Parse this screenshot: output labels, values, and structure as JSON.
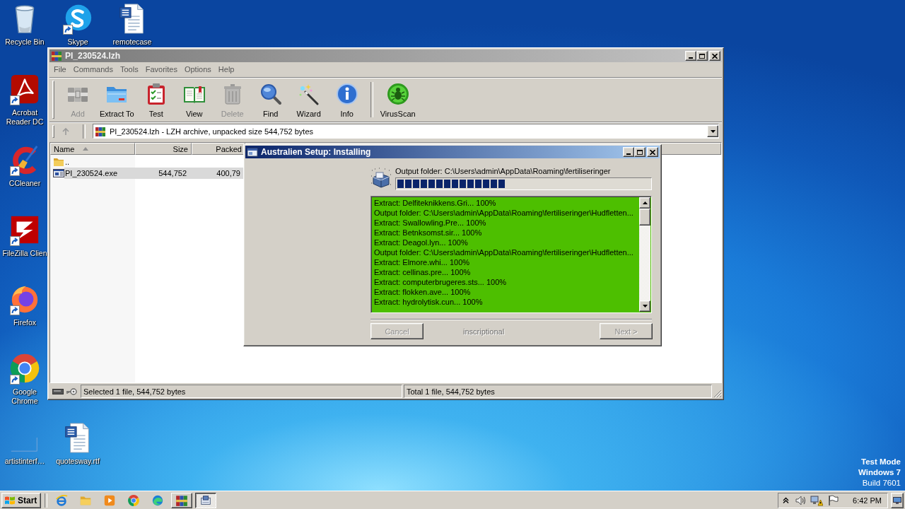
{
  "desktop": {
    "icons": [
      {
        "label": "Recycle Bin",
        "shortcut": false
      },
      {
        "label": "Skype",
        "shortcut": true
      },
      {
        "label": "remotecase",
        "shortcut": false
      },
      {
        "label": "Acrobat Reader DC",
        "shortcut": true
      },
      {
        "label": "CCleaner",
        "shortcut": true
      },
      {
        "label": "FileZilla Clien",
        "shortcut": true
      },
      {
        "label": "Firefox",
        "shortcut": true
      },
      {
        "label": "Google Chrome",
        "shortcut": true
      },
      {
        "label": "artistinterf…",
        "shortcut": false
      },
      {
        "label": "quotesway.rtf",
        "shortcut": false
      }
    ],
    "os_notice": [
      {
        "text": "Test Mode",
        "bold": true
      },
      {
        "text": "Windows 7",
        "bold": true
      },
      {
        "text": "Build 7601",
        "bold": false
      }
    ]
  },
  "winrar": {
    "title": "PI_230524.lzh",
    "active": false,
    "menu": [
      "File",
      "Commands",
      "Tools",
      "Favorites",
      "Options",
      "Help"
    ],
    "toolbar": [
      {
        "buttons": [
          {
            "label": "Add",
            "disabled": true
          },
          {
            "label": "Extract To",
            "disabled": false
          },
          {
            "label": "Test",
            "disabled": false
          },
          {
            "label": "View",
            "disabled": false
          },
          {
            "label": "Delete",
            "disabled": true
          },
          {
            "label": "Find",
            "disabled": false
          },
          {
            "label": "Wizard",
            "disabled": false
          },
          {
            "label": "Info",
            "disabled": false
          }
        ]
      },
      {
        "buttons": [
          {
            "label": "VirusScan",
            "disabled": false
          }
        ]
      }
    ],
    "address": "PI_230524.lzh - LZH archive, unpacked size 544,752 bytes",
    "file_list": {
      "columns": [
        {
          "label": "Name",
          "sorted": true
        },
        {
          "label": "Size",
          "sorted": false
        },
        {
          "label": "Packed",
          "sorted": false
        }
      ],
      "rows": [
        {
          "kind": "folder",
          "name": "..",
          "selected": false
        },
        {
          "kind": "file",
          "name": "PI_230524.exe",
          "size": "544,752",
          "packed": "400,79",
          "selected": true
        }
      ]
    },
    "status_bar": [
      "Selected 1 file, 544,752 bytes",
      "Total 1 file, 544,752 bytes"
    ]
  },
  "setup": {
    "title": "Australien Setup: Installing",
    "active": true,
    "status": "Output folder: C:\\Users\\admin\\AppData\\Roaming\\fertiliseringer",
    "progress": {
      "level": 0.43
    },
    "log": [
      "Extract: Delfiteknikkens.Gri... 100%",
      "Output folder: C:\\Users\\admin\\AppData\\Roaming\\fertiliseringer\\Hudfletten...",
      "Extract: Swallowling.Pre... 100%",
      "Extract: Betnksomst.sir... 100%",
      "Extract: Deagol.lyn... 100%",
      "Output folder: C:\\Users\\admin\\AppData\\Roaming\\fertiliseringer\\Hudfletten...",
      "Extract: Elmore.whi... 100%",
      "Extract: cellinas.pre... 100%",
      "Extract: computerbrugeres.sts... 100%",
      "Extract: flokken.ave... 100%",
      "Extract: hydrolytisk.cun... 100%"
    ],
    "buttons": [
      {
        "label": "Cancel",
        "disabled": true
      },
      {
        "label": "Next >",
        "disabled": true
      }
    ],
    "branding": "inscriptional"
  },
  "taskbar": {
    "start": "Start",
    "apps": [
      {
        "running": false,
        "selected": false
      },
      {
        "running": false,
        "selected": false
      },
      {
        "running": false,
        "selected": false
      },
      {
        "running": false,
        "selected": false
      },
      {
        "running": false,
        "selected": false
      },
      {
        "running": true,
        "selected": false
      },
      {
        "running": true,
        "selected": true
      }
    ],
    "clock": "6:42 PM"
  }
}
